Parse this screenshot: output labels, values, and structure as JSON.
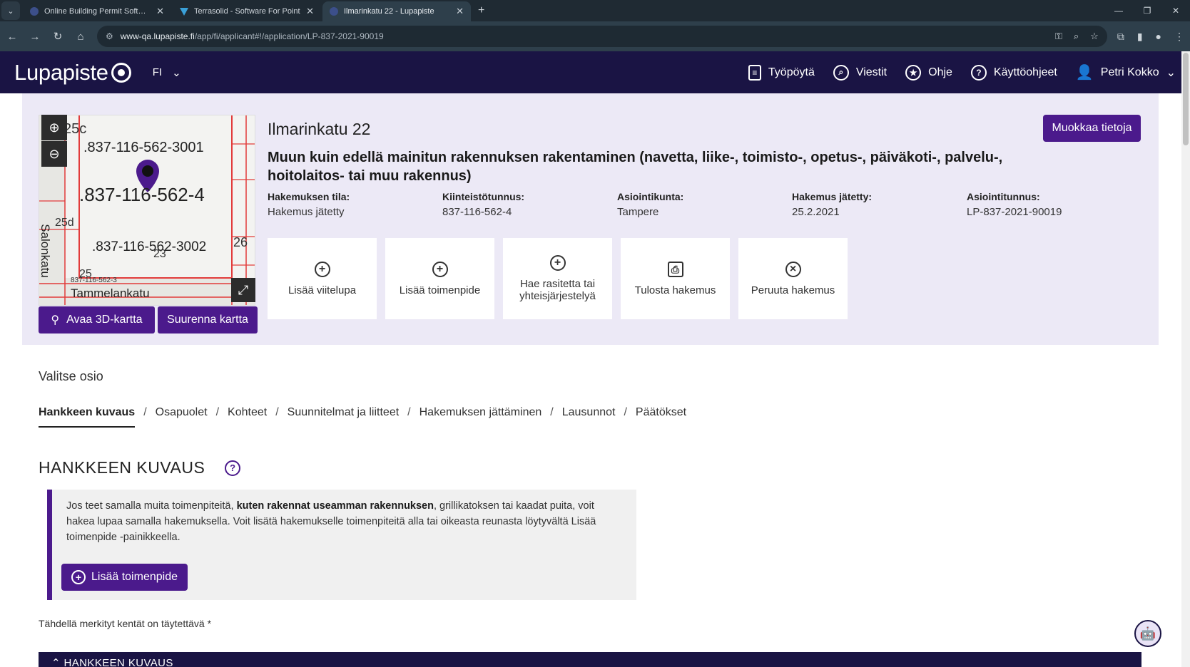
{
  "browser": {
    "tabs": [
      {
        "title": "Online Building Permit Softwar",
        "active": false
      },
      {
        "title": "Terrasolid - Software For Point",
        "active": false
      },
      {
        "title": "Ilmarinkatu 22 - Lupapiste",
        "active": true
      }
    ],
    "url_domain": "www-qa.lupapiste.fi",
    "url_path": "/app/fi/applicant#!/application/LP-837-2021-90019"
  },
  "header": {
    "logo": "Lupapiste",
    "language": "FI",
    "nav": [
      {
        "label": "Työpöytä",
        "icon": "document-icon"
      },
      {
        "label": "Viestit",
        "icon": "chat-icon"
      },
      {
        "label": "Ohje",
        "icon": "star-icon"
      },
      {
        "label": "Käyttöohjeet",
        "icon": "question-icon"
      }
    ],
    "user": "Petri Kokko"
  },
  "map": {
    "labels": {
      "prop_main": ".837-116-562-4",
      "prop_a": ".837-116-562-3001",
      "prop_b": ".837-116-562-3002",
      "prop_small": "837-116-562-3",
      "street_h": "Tammelankatu",
      "street_v": "Salonkatu",
      "n25c": "25c",
      "n25d": "25d",
      "n26": "26",
      "n25": "25",
      "n23": "23"
    },
    "open_3d": "Avaa 3D-kartta",
    "enlarge": "Suurenna kartta"
  },
  "application": {
    "address": "Ilmarinkatu 22",
    "operation": "Muun kuin edellä mainitun rakennuksen rakentaminen (navetta, liike-, toimisto-, opetus-, päiväkoti-, palvelu-, hoitolaitos- tai muu rakennus)",
    "edit_label": "Muokkaa tietoja",
    "fields": [
      {
        "label": "Hakemuksen tila:",
        "value": "Hakemus jätetty"
      },
      {
        "label": "Kiinteistötunnus:",
        "value": "837-116-562-4"
      },
      {
        "label": "Asiointikunta:",
        "value": "Tampere"
      },
      {
        "label": "Hakemus jätetty:",
        "value": "25.2.2021"
      },
      {
        "label": "Asiointitunnus:",
        "value": "LP-837-2021-90019"
      }
    ],
    "actions": [
      {
        "label": "Lisää viitelupa",
        "icon": "plus-circle-icon"
      },
      {
        "label": "Lisää toimenpide",
        "icon": "plus-circle-icon"
      },
      {
        "label": "Hae rasitetta tai yhteisjärjestelyä",
        "icon": "plus-circle-icon"
      },
      {
        "label": "Tulosta hakemus",
        "icon": "print-icon"
      },
      {
        "label": "Peruuta hakemus",
        "icon": "cancel-circle-icon"
      }
    ]
  },
  "sections": {
    "label": "Valitse osio",
    "items": [
      "Hankkeen kuvaus",
      "Osapuolet",
      "Kohteet",
      "Suunnitelmat ja liitteet",
      "Hakemuksen jättäminen",
      "Lausunnot",
      "Päätökset"
    ],
    "current": "Hankkeen kuvaus"
  },
  "content": {
    "heading": "HANKKEEN KUVAUS",
    "info_pre": "Jos teet samalla muita toimenpiteitä, ",
    "info_bold": "kuten rakennat useamman rakennuksen",
    "info_post": ", grillikatoksen tai kaadat puita, voit hakea lupaa samalla hakemuksella. Voit lisätä hakemukselle toimenpiteitä alla tai oikeasta reunasta löytyvältä Lisää toimenpide -painikkeella.",
    "add_operation": "Lisää toimenpide",
    "required_note": "Tähdellä merkityt kentät on täytettävä *",
    "accordion_title": "HANKKEEN KUVAUS"
  }
}
